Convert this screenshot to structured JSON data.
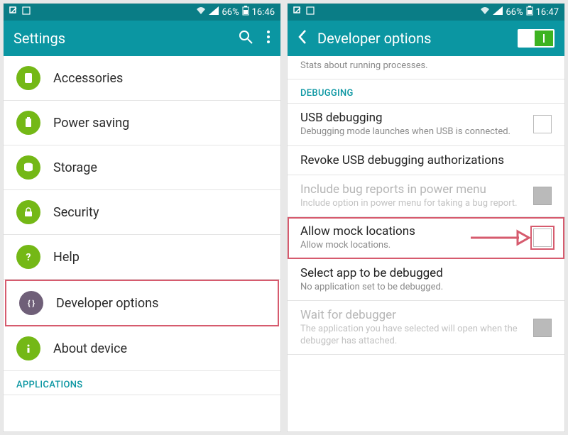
{
  "left": {
    "status": {
      "battery": "66%",
      "time": "16:46"
    },
    "appbar": {
      "title": "Settings"
    },
    "items": [
      {
        "label": "Accessories",
        "icon": "accessories-icon"
      },
      {
        "label": "Power saving",
        "icon": "power-icon"
      },
      {
        "label": "Storage",
        "icon": "storage-icon"
      },
      {
        "label": "Security",
        "icon": "security-icon"
      },
      {
        "label": "Help",
        "icon": "help-icon"
      },
      {
        "label": "Developer options",
        "icon": "dev-icon"
      },
      {
        "label": "About device",
        "icon": "about-icon"
      }
    ],
    "section": "APPLICATIONS"
  },
  "right": {
    "status": {
      "battery": "66%",
      "time": "16:47"
    },
    "appbar": {
      "title": "Developer options"
    },
    "partial_sub": "Stats about running processes.",
    "section_debugging": "DEBUGGING",
    "rows": [
      {
        "title": "USB debugging",
        "sub": "Debugging mode launches when USB is connected.",
        "checkbox": true
      },
      {
        "title": "Revoke USB debugging authorizations"
      },
      {
        "title": "Include bug reports in power menu",
        "sub": "Include option in power menu for taking a bug report.",
        "checkbox": true,
        "disabled": true
      },
      {
        "title": "Allow mock locations",
        "sub": "Allow mock locations.",
        "checkbox": true
      },
      {
        "title": "Select app to be debugged",
        "sub": "No application set to be debugged."
      },
      {
        "title": "Wait for debugger",
        "sub": "The application you have selected will open when the debugger has attached.",
        "checkbox": true,
        "disabled": true
      }
    ]
  }
}
